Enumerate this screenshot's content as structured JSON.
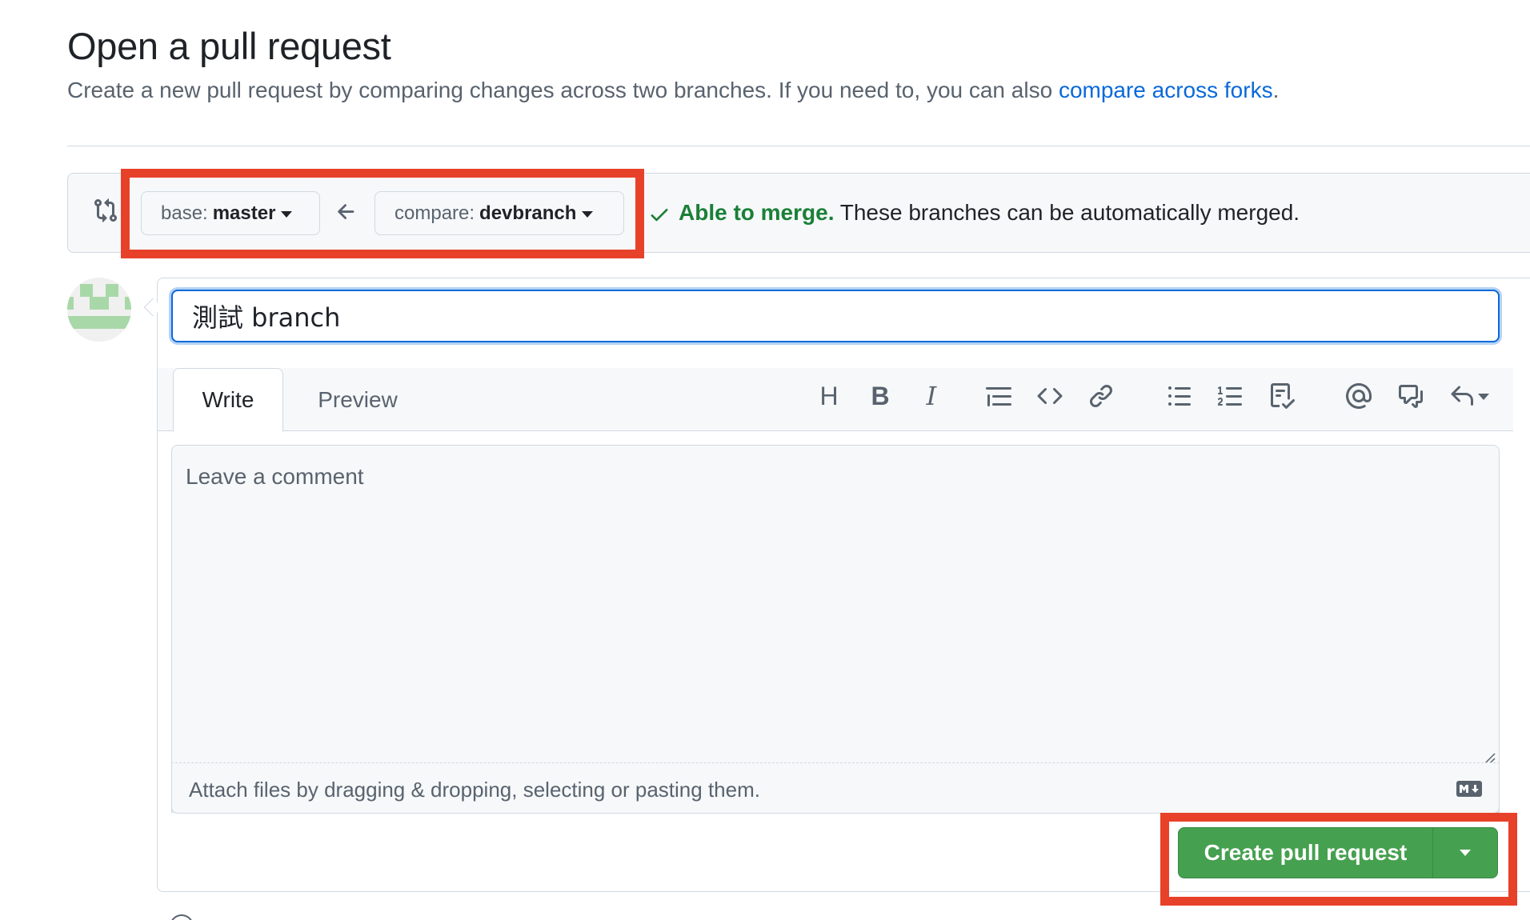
{
  "page": {
    "title": "Open a pull request",
    "description": "Create a new pull request by comparing changes across two branches. If you need to, you can also ",
    "description_link": "compare across forks",
    "description_end": "."
  },
  "range": {
    "base_label": "base:",
    "base_value": "master",
    "compare_label": "compare:",
    "compare_value": "devbranch",
    "merge_ok": "Able to merge.",
    "merge_detail": " These branches can be automatically merged."
  },
  "compose": {
    "title_value": "測試 branch",
    "tabs": [
      {
        "label": "Write"
      },
      {
        "label": "Preview"
      }
    ],
    "toolbar": {
      "heading": "H",
      "bold": "B",
      "italic": "I"
    },
    "comment_placeholder": "Leave a comment",
    "attach_text": "Attach files by dragging & dropping, selecting or pasting them.",
    "create_label": "Create pull request"
  },
  "colors": {
    "accent_blue": "#0969da",
    "merge_green": "#1a7f37",
    "create_green": "#45a04f",
    "highlight_red": "#e8412a"
  },
  "icons": [
    "git-compare-icon",
    "arrow-left-icon",
    "check-icon",
    "avatar",
    "quote-icon",
    "code-icon",
    "link-icon",
    "unordered-list-icon",
    "ordered-list-icon",
    "task-list-icon",
    "mention-icon",
    "cross-reference-icon",
    "reply-icon",
    "markdown-icon",
    "chevron-down-icon"
  ]
}
